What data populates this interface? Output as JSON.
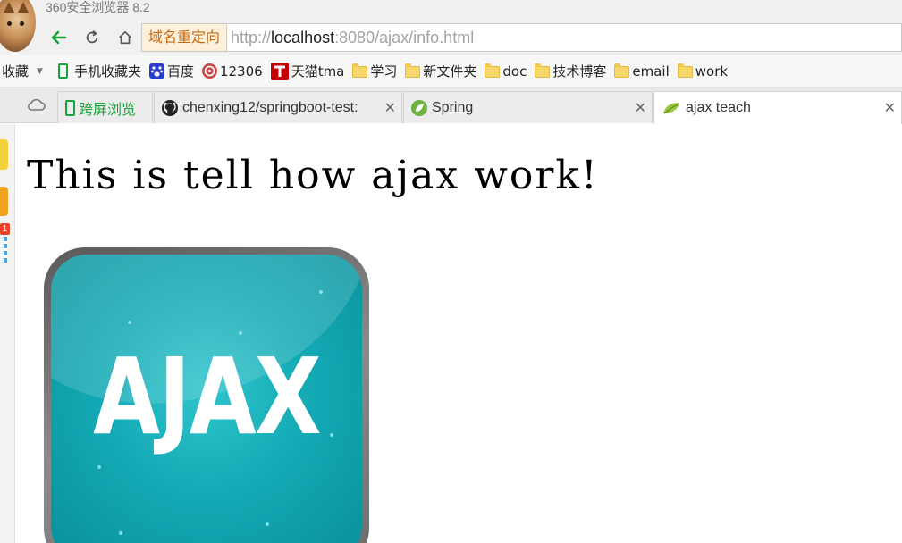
{
  "window": {
    "title": "360安全浏览器 8.2"
  },
  "address_bar": {
    "badge": "域名重定向",
    "url_scheme": "http://",
    "url_host": "localhost",
    "url_rest": ":8080/ajax/info.html"
  },
  "bookmarks": {
    "label": "收藏",
    "items": [
      {
        "label": "手机收藏夹",
        "icon": "phone-icon"
      },
      {
        "label": "百度",
        "icon": "baidu-paw-icon"
      },
      {
        "label": "12306",
        "icon": "railway-icon"
      },
      {
        "label": "天猫tma",
        "icon": "tmall-icon"
      },
      {
        "label": "学习",
        "icon": "folder-icon"
      },
      {
        "label": "新文件夹",
        "icon": "folder-icon"
      },
      {
        "label": "doc",
        "icon": "folder-icon"
      },
      {
        "label": "技术博客",
        "icon": "folder-icon"
      },
      {
        "label": "email",
        "icon": "folder-icon"
      },
      {
        "label": "work",
        "icon": "folder-icon"
      }
    ]
  },
  "tabs": [
    {
      "label": "跨屏浏览",
      "icon": "phone-icon"
    },
    {
      "label": "chenxing12/springboot-test:",
      "icon": "github-icon"
    },
    {
      "label": "Spring",
      "icon": "spring-leaf-icon"
    },
    {
      "label": "ajax teach",
      "icon": "spring-leaf-icon",
      "active": true
    }
  ],
  "sidebar": {
    "badge_count": "1"
  },
  "page": {
    "heading": "This is tell how ajax work!",
    "logo_text": "AJAX"
  },
  "colors": {
    "accent_green": "#1aa33a",
    "badge_orange": "#c46a12",
    "logo_teal": "#13aab5"
  }
}
